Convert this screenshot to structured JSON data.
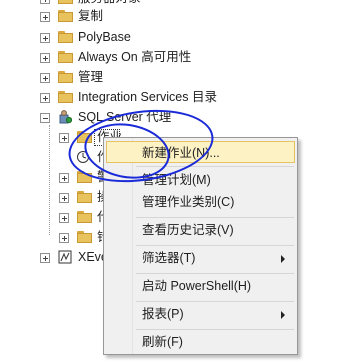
{
  "tree": {
    "top_partial": "服务器对象",
    "items": [
      {
        "label": "复制"
      },
      {
        "label": "PolyBase"
      },
      {
        "label": "Always On 高可用性"
      },
      {
        "label": "管理"
      },
      {
        "label": "Integration Services 目录"
      },
      {
        "label": "SQL Server 代理"
      },
      {
        "label": "作业"
      },
      {
        "label": "作"
      },
      {
        "label": "警"
      },
      {
        "label": "操"
      },
      {
        "label": "代"
      },
      {
        "label": "错"
      },
      {
        "label": "XEve"
      }
    ]
  },
  "context_menu": {
    "items": [
      {
        "label": "新建作业(N)..."
      },
      {
        "label": "管理计划(M)"
      },
      {
        "label": "管理作业类别(C)"
      },
      {
        "label": "查看历史记录(V)"
      },
      {
        "label": "筛选器(T)"
      },
      {
        "label": "启动 PowerShell(H)"
      },
      {
        "label": "报表(P)"
      },
      {
        "label": "刷新(F)"
      }
    ]
  },
  "colors": {
    "highlight": "#fdf2c4",
    "annotation": "#1a2ad8",
    "folder": "#e8c25c"
  }
}
